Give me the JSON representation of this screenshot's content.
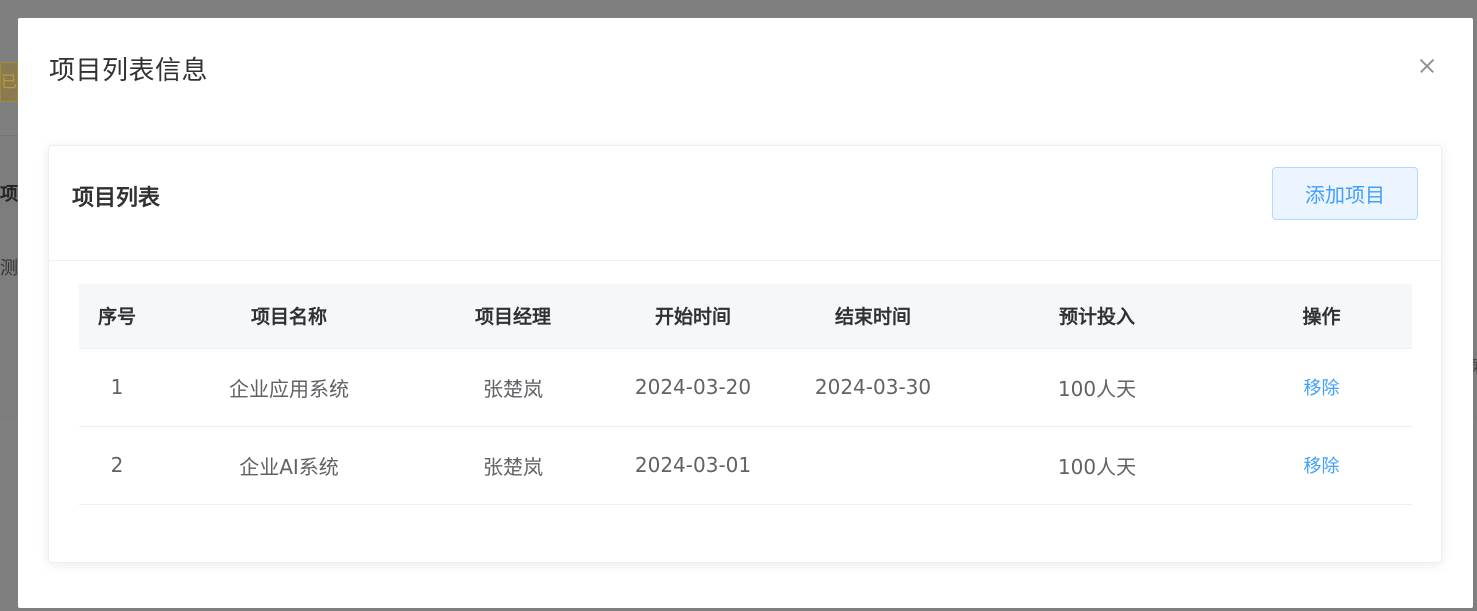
{
  "background": {
    "frag1": "已",
    "frag2": "项目",
    "frag3": "测试",
    "frag4": "第"
  },
  "modal": {
    "title": "项目列表信息",
    "close_icon": "close-icon"
  },
  "card": {
    "title": "项目列表",
    "add_button_label": "添加项目"
  },
  "table": {
    "columns": [
      "序号",
      "项目名称",
      "项目经理",
      "开始时间",
      "结束时间",
      "预计投入",
      "操作"
    ],
    "rows": [
      {
        "index": "1",
        "name": "企业应用系统",
        "manager": "张楚岚",
        "start": "2024-03-20",
        "end": "2024-03-30",
        "effort": "100人天",
        "action": "移除"
      },
      {
        "index": "2",
        "name": "企业AI系统",
        "manager": "张楚岚",
        "start": "2024-03-01",
        "end": "",
        "effort": "100人天",
        "action": "移除"
      }
    ]
  },
  "colors": {
    "primary": "#409eff",
    "primary_light_bg": "#ecf5ff",
    "primary_border": "#b3d8ff",
    "header_bg": "#f5f7fa",
    "border": "#ebeef5",
    "overlay": "#808080"
  }
}
